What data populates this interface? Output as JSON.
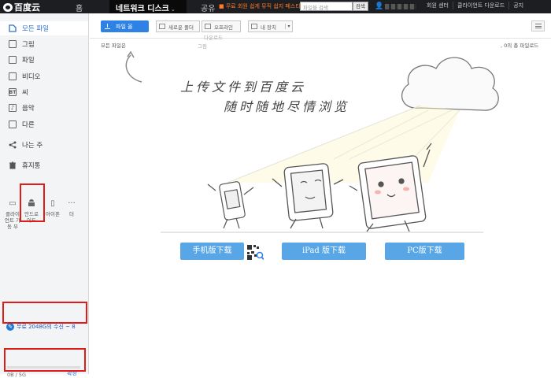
{
  "topbar": {
    "logo": "百度云",
    "nav": {
      "home": "홈",
      "netdisk": "네트워크 디스크",
      "share": "공유"
    },
    "promo": "■ 무료 회원 쉽게 뮤직 쉽지 페스티벌 티켓!",
    "search": {
      "placeholder": "파일을 검색",
      "button": "검색"
    },
    "links": [
      "회원 센터",
      "클라이언트 다운로드",
      "공지"
    ]
  },
  "sidebar": {
    "items": [
      {
        "label": "모든 파일",
        "icon": "file-icon"
      },
      {
        "label": "그림",
        "icon": "image-icon"
      },
      {
        "label": "파일",
        "icon": "document-icon"
      },
      {
        "label": "비디오",
        "icon": "video-icon"
      },
      {
        "label": "씨",
        "icon": "bt-icon"
      },
      {
        "label": "음악",
        "icon": "music-icon"
      },
      {
        "label": "다른",
        "icon": "other-icon"
      },
      {
        "label": "나는 주",
        "icon": "share-icon"
      },
      {
        "label": "휴지통",
        "icon": "trash-icon"
      }
    ],
    "devices": [
      {
        "label": "클라이언트 가동 부",
        "icon": "monitor-icon"
      },
      {
        "label": "안드로이드",
        "icon": "android-icon"
      },
      {
        "label": "아이폰",
        "icon": "phone-icon"
      },
      {
        "label": "더",
        "icon": "more-icon"
      }
    ],
    "bt_badge": "BT",
    "promo": "무료 2048G의 수신 ~ 8",
    "quota": {
      "used_text": "0B / 5G",
      "expand": "확장",
      "used_fraction": 0
    }
  },
  "toolbar": {
    "upload": "파일 올",
    "new_folder": "새로운 폴더",
    "offline": "오프라인",
    "offline_sub": "다운로드",
    "my_device": "내 장치",
    "image_sub": "그림"
  },
  "breadcrumb": "모든 파일은",
  "file_count": ", 0의 총 파일로드",
  "hero": {
    "line1": "上传文件到百度云",
    "line2": "随时随地尽情浏览",
    "buttons": [
      "手机版下载",
      "iPad 版下载",
      "PC版下载"
    ]
  },
  "colors": {
    "accent": "#2e82e6",
    "topbar": "#1d1e21",
    "download_button": "#58a6e6",
    "highlight_box": "#e21a1a"
  }
}
